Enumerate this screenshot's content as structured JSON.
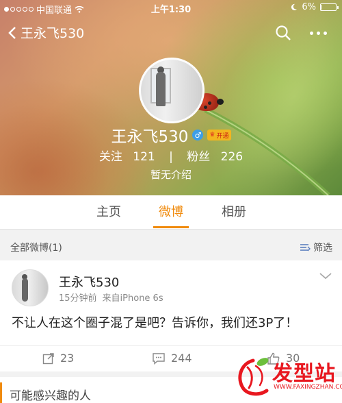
{
  "status_bar": {
    "carrier": "中国联通",
    "time": "上午1:30",
    "battery": "6%",
    "battery_level": 0.06
  },
  "nav": {
    "back_label": "王永飞530"
  },
  "profile": {
    "name": "王永飞530",
    "vip_label": "开通",
    "following_label": "关注",
    "following_count": "121",
    "separator": "|",
    "followers_label": "粉丝",
    "followers_count": "226",
    "intro": "暂无介绍"
  },
  "tabs": [
    {
      "label": "主页"
    },
    {
      "label": "微博"
    },
    {
      "label": "相册"
    }
  ],
  "filter_bar": {
    "count_label": "全部微博(1)",
    "filter_label": "筛选"
  },
  "post": {
    "author": "王永飞530",
    "time": "15分钟前",
    "source": "来自iPhone 6s",
    "text": "不让人在这个圈子混了是吧？告诉你，我们还3P了！",
    "reposts": "23",
    "comments": "244",
    "likes": "30"
  },
  "recommend": {
    "title": "可能感兴趣的人"
  },
  "watermark": {
    "brand": "发型站",
    "url": "WWW.FAXINGZHAN.COM"
  },
  "colors": {
    "accent": "#f08b0e",
    "watermark": "#e8171f"
  }
}
